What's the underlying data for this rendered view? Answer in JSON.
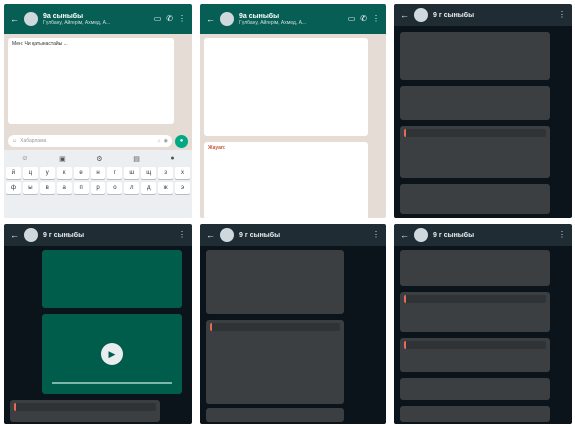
{
  "screens": [
    {
      "header": {
        "name": "9a сыныбы",
        "members": "Гүлбану, Айгерім, Ахмед, А..."
      },
      "messages": [
        "Мен: Чи қатынастайы ...",
        "",
        ""
      ],
      "input_placeholder": "Хабарлама",
      "keyboard_rows": [
        [
          "й",
          "ц",
          "у",
          "к",
          "е",
          "н",
          "г",
          "ш",
          "щ",
          "з",
          "х"
        ],
        [
          "ф",
          "ы",
          "в",
          "а",
          "п",
          "р",
          "о",
          "л",
          "д",
          "ж",
          "э"
        ]
      ]
    },
    {
      "header": {
        "name": "9a сыныбы",
        "members": "Гүлбану, Айгерім, Ахмед, А..."
      },
      "messages": [
        "",
        "Жауап:",
        ""
      ]
    },
    {
      "header": {
        "name": "9 г сыныбы"
      },
      "messages": [
        "",
        "",
        "",
        ""
      ]
    },
    {
      "header": {
        "name": "9 г сыныбы"
      },
      "messages": [
        "",
        ""
      ]
    },
    {
      "header": {
        "name": "9 г сыныбы"
      },
      "messages": [
        "",
        "",
        ""
      ]
    },
    {
      "header": {
        "name": "9 г сыныбы"
      },
      "messages": [
        "",
        "",
        "",
        "",
        ""
      ]
    }
  ]
}
